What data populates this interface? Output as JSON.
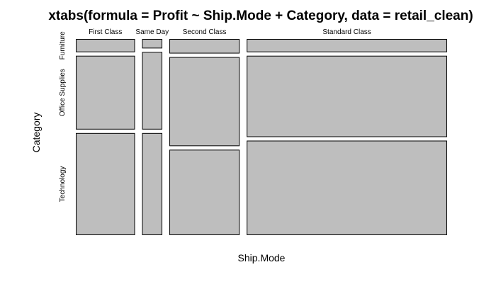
{
  "chart_data": {
    "type": "mosaic",
    "title": "xtabs(formula = Profit ~ Ship.Mode + Category, data = retail_clean)",
    "xlabel": "Ship.Mode",
    "ylabel": "Category",
    "fill_color": "#bebebe",
    "categories": [
      "First Class",
      "Same Day",
      "Second Class",
      "Standard Class"
    ],
    "column_fractions": [
      0.155,
      0.053,
      0.184,
      0.525
    ],
    "rows": [
      "Furniture",
      "Office Supplies",
      "Technology"
    ],
    "row_fractions": [
      [
        0.07,
        0.39,
        0.54
      ],
      [
        0.05,
        0.41,
        0.54
      ],
      [
        0.08,
        0.49,
        0.47
      ],
      [
        0.07,
        0.43,
        0.5
      ]
    ]
  }
}
